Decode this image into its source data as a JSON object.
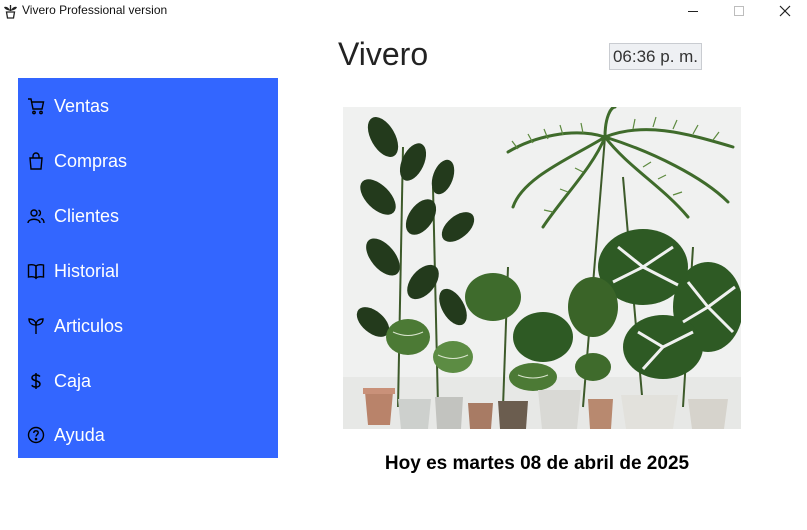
{
  "window": {
    "title": "Vivero Professional version",
    "app_icon": "plant-pot-icon"
  },
  "header": {
    "title": "Vivero",
    "clock": "06:36 p. m."
  },
  "sidebar": {
    "accent_color": "#3366ff",
    "items": [
      {
        "label": "Ventas",
        "icon": "cart-icon"
      },
      {
        "label": "Compras",
        "icon": "shopping-bag-icon"
      },
      {
        "label": "Clientes",
        "icon": "users-icon"
      },
      {
        "label": "Historial",
        "icon": "book-icon"
      },
      {
        "label": "Articulos",
        "icon": "sprout-icon"
      },
      {
        "label": "Caja",
        "icon": "dollar-icon"
      },
      {
        "label": "Ayuda",
        "icon": "help-circle-icon"
      }
    ]
  },
  "main": {
    "date_text": "Hoy es martes 08 de abril de 2025"
  }
}
